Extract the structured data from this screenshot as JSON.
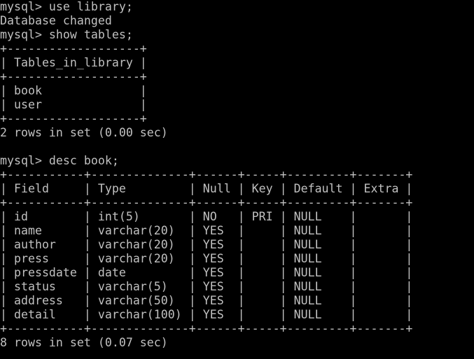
{
  "terminal": {
    "lines": [
      "mysql> use library;",
      "Database changed",
      "mysql> show tables;",
      "+-------------------+",
      "| Tables_in_library |",
      "+-------------------+",
      "| book              |",
      "| user              |",
      "+-------------------+",
      "2 rows in set (0.00 sec)",
      "",
      "mysql> desc book;",
      "+-----------+--------------+------+-----+---------+-------+",
      "| Field     | Type         | Null | Key | Default | Extra |",
      "+-----------+--------------+------+-----+---------+-------+",
      "| id        | int(5)       | NO   | PRI | NULL    |       |",
      "| name      | varchar(20)  | YES  |     | NULL    |       |",
      "| author    | varchar(20)  | YES  |     | NULL    |       |",
      "| press     | varchar(20)  | YES  |     | NULL    |       |",
      "| pressdate | date         | YES  |     | NULL    |       |",
      "| status    | varchar(5)   | YES  |     | NULL    |       |",
      "| address   | varchar(50)  | YES  |     | NULL    |       |",
      "| detail    | varchar(100) | YES  |     | NULL    |       |",
      "+-----------+--------------+------+-----+---------+-------+",
      "8 rows in set (0.07 sec)"
    ]
  }
}
